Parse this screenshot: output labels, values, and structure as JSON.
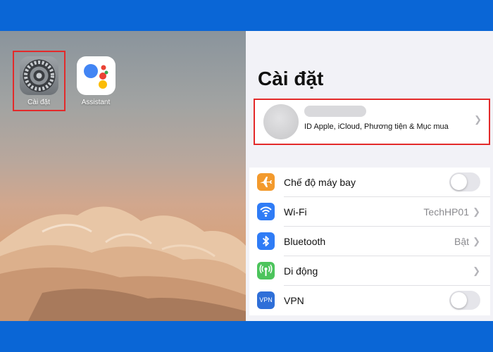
{
  "home": {
    "apps": [
      {
        "label": "Cài đặt",
        "icon": "gear-icon"
      },
      {
        "label": "Assistant",
        "icon": "google-assistant-icon"
      }
    ]
  },
  "settings": {
    "title": "Cài đặt",
    "profile": {
      "subtitle": "ID Apple, iCloud, Phương tiện & Mục mua"
    },
    "rows": [
      {
        "label": "Chế độ máy bay",
        "icon": "airplane-icon",
        "color": "#f39a2d",
        "control": "toggle",
        "on": false
      },
      {
        "label": "Wi-Fi",
        "icon": "wifi-icon",
        "color": "#2f7cf6",
        "value": "TechHP01"
      },
      {
        "label": "Bluetooth",
        "icon": "bluetooth-icon",
        "color": "#2f7cf6",
        "value": "Bật"
      },
      {
        "label": "Di động",
        "icon": "cellular-icon",
        "color": "#4cc45c"
      },
      {
        "label": "VPN",
        "icon": "vpn-icon",
        "color": "#2f6fd8",
        "icon_text": "VPN",
        "control": "toggle",
        "on": false
      }
    ]
  },
  "colors": {
    "frame_blue": "#0a66d6",
    "highlight_red": "#e32a2a"
  }
}
